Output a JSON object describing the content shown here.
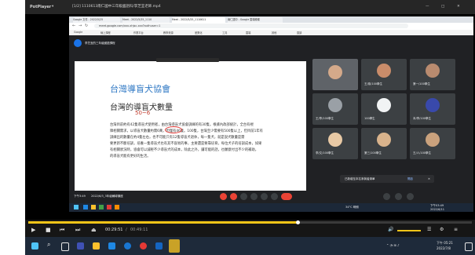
{
  "potplayer": {
    "app_name": "PotPlayer",
    "menu_caret": "▾",
    "file_title": "[1/2] 1110613南仁國中三年級國語科/李芝宜老師.mp4",
    "current_time": "00:29:51",
    "total_time": "00:49:11"
  },
  "browser": {
    "tabs": [
      "Google 文件 - 2022/5/25",
      "Meet - 2022/5/25_1110",
      "Meet - 2022/5/25_1110611",
      "南仁國中 - Google 雲端硬碟"
    ],
    "url": "meet.google.com/xxx-xhjsc-xxx?authuser=1",
    "bookmarks": [
      "Google",
      "線上課程",
      "作業平台",
      "教學資源",
      "差異化",
      "工具",
      "雲端",
      "其他",
      "閱讀"
    ]
  },
  "meet": {
    "meeting_label": "李芝宜的三年級國語課程",
    "time": "下午3:49",
    "meeting_code": "2022/6/3_3年級輔導講座",
    "notification": "已新增至本名參與者清單",
    "notification_action": "開啟",
    "participants": [
      "王/臺/100學生",
      "第一/100學生",
      "王/李/100學生",
      "100學生",
      "本/李/100學生",
      "李/文/100學生",
      "第三/100學生",
      "王/人/100學生",
      "本學/100學生"
    ],
    "presenter_label": "李芝宜"
  },
  "slide": {
    "title": "台灣導盲犬協會",
    "subtitle": "台灣的導盲犬數量",
    "annotation": "50~6",
    "paragraph_lines": [
      "台灣目前約有42隻導盲犬使用者，由台灣導盲犬協會訓練的有30隻。根據內政部統計，全台有視",
      "障相關需求，以導盲犬數量約需6萬，但僅有46隻。100隻，台灣至少需要有500隻以上，但目前1年有",
      "訓練出的數量在約4隻左右，也不可能只有12隻導盲犬退休，每一隻犬，就是說犬數量是需",
      "要更新不斷培訓，培養一隻導盲犬也有其不容易的事，主要還是要靠培育，每位犬子的培訓成本，如果",
      "有相關狀況時，協會可以減輕不少導盲犬的成本，除此之外，讓可能的話，也願意付出不少的補助，",
      "的導盲犬能有更好的生活。"
    ]
  },
  "inner_taskbar": {
    "weather": "34°C 晴朗",
    "time": "下午03:49",
    "date": "2022/6/11"
  },
  "taskbar": {
    "time": "下午 05:21",
    "date": "2022/7/8"
  }
}
